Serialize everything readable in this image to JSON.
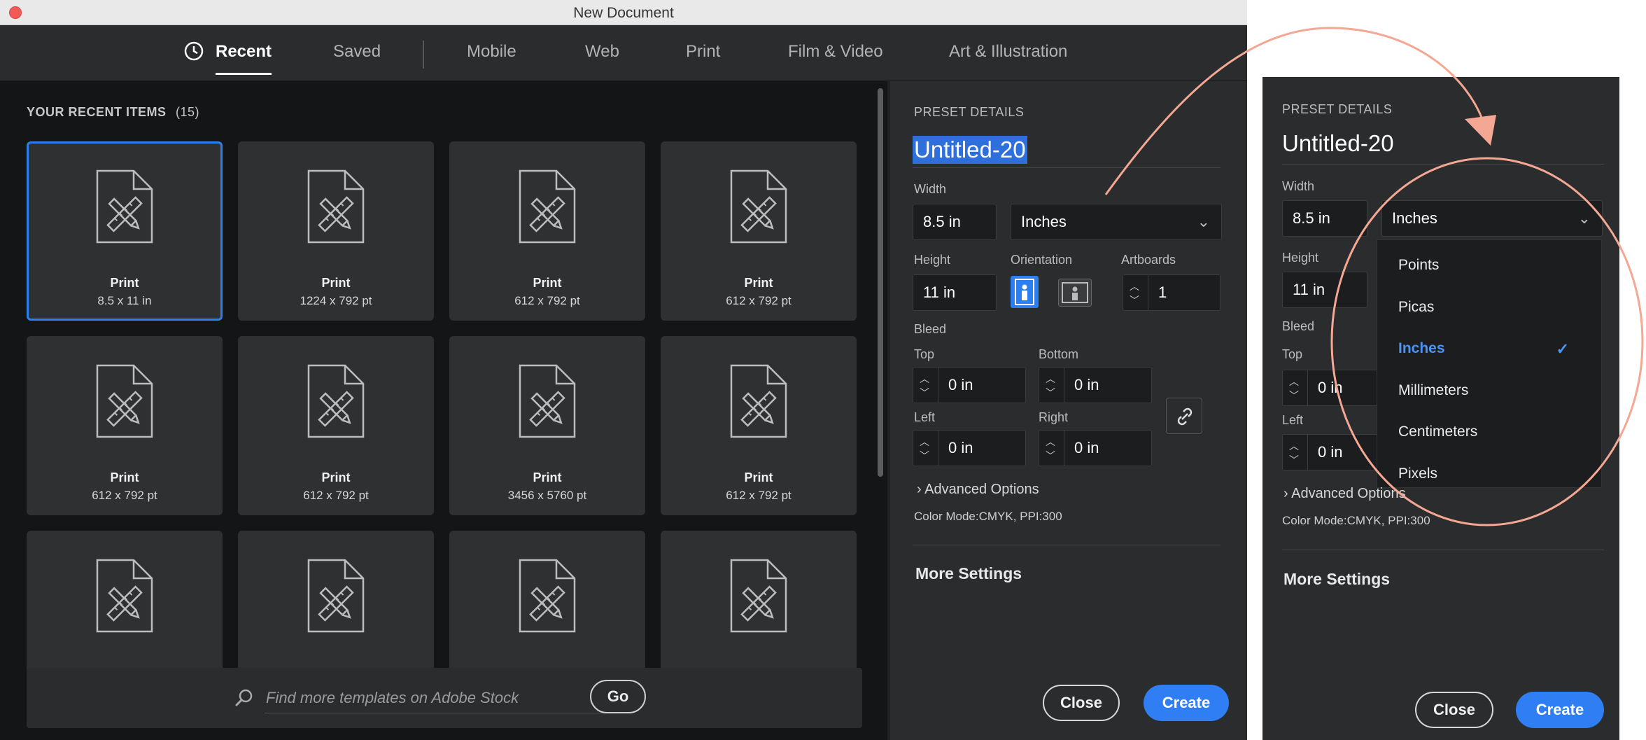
{
  "window": {
    "title": "New Document"
  },
  "tabs": [
    {
      "label": "Recent",
      "active": true
    },
    {
      "label": "Saved"
    },
    {
      "label": "Mobile"
    },
    {
      "label": "Web"
    },
    {
      "label": "Print"
    },
    {
      "label": "Film & Video"
    },
    {
      "label": "Art & Illustration"
    }
  ],
  "recent": {
    "label": "YOUR RECENT ITEMS",
    "count": "(15)",
    "items": [
      {
        "name": "Print",
        "size": "8.5 x 11 in"
      },
      {
        "name": "Print",
        "size": "1224 x 792 pt"
      },
      {
        "name": "Print",
        "size": "612 x 792 pt"
      },
      {
        "name": "Print",
        "size": "612 x 792 pt"
      },
      {
        "name": "Print",
        "size": "612 x 792 pt"
      },
      {
        "name": "Print",
        "size": "612 x 792 pt"
      },
      {
        "name": "Print",
        "size": "3456 x 5760 pt"
      },
      {
        "name": "Print",
        "size": "612 x 792 pt"
      },
      {
        "name": "",
        "size": ""
      },
      {
        "name": "",
        "size": ""
      },
      {
        "name": "",
        "size": ""
      },
      {
        "name": "",
        "size": ""
      }
    ]
  },
  "search": {
    "placeholder": "Find more templates on Adobe Stock",
    "go_label": "Go"
  },
  "preset": {
    "section_label": "PRESET DETAILS",
    "name": "Untitled-20",
    "width_label": "Width",
    "width_value": "8.5 in",
    "unit": "Inches",
    "height_label": "Height",
    "height_value": "11 in",
    "orientation_label": "Orientation",
    "artboards_label": "Artboards",
    "artboards_value": "1",
    "bleed_label": "Bleed",
    "top_label": "Top",
    "top_value": "0 in",
    "bottom_label": "Bottom",
    "bottom_value": "0 in",
    "left_label": "Left",
    "left_value": "0 in",
    "right_label": "Right",
    "right_value": "0 in",
    "advanced_label": "Advanced Options",
    "color_mode": "Color Mode:CMYK, PPI:300",
    "more_settings": "More Settings",
    "close_label": "Close",
    "create_label": "Create"
  },
  "units_menu": {
    "options": [
      "Points",
      "Picas",
      "Inches",
      "Millimeters",
      "Centimeters",
      "Pixels"
    ],
    "selected": "Inches"
  },
  "colors": {
    "accent": "#2f7ef3",
    "annotation": "#f4a792",
    "bg": "#1f2122"
  }
}
